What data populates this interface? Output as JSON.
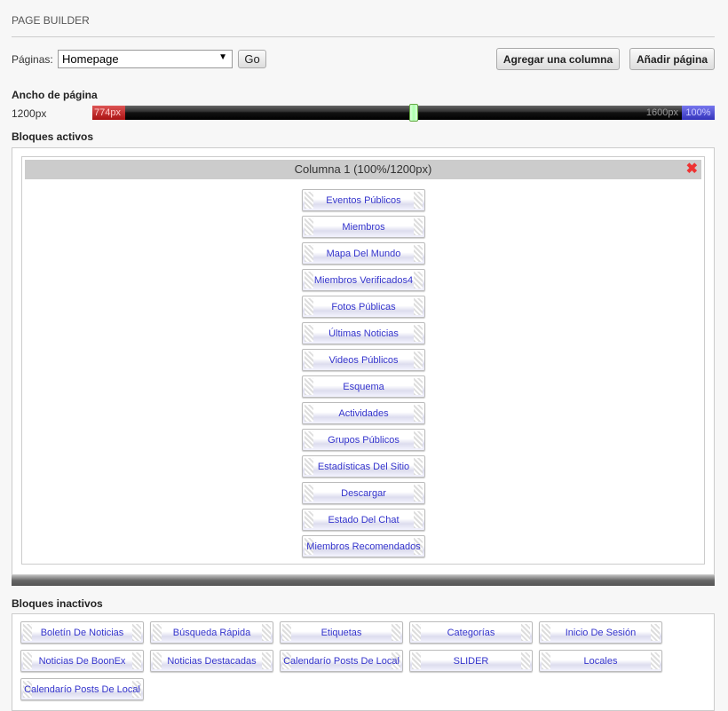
{
  "header": {
    "title": "PAGE BUILDER"
  },
  "toolbar": {
    "pages_label": "Páginas:",
    "selected_page": "Homepage",
    "go_label": "Go",
    "add_column_label": "Agregar una columna",
    "add_page_label": "Añadir página"
  },
  "width": {
    "label": "Ancho de página",
    "value": "1200px",
    "min_label": "774px",
    "max_label": "1600px",
    "percent_label": "100%",
    "min": 774,
    "max": 1600,
    "current": 1200
  },
  "active": {
    "label": "Bloques activos",
    "column_title": "Columna 1 (100%/1200px)",
    "blocks": [
      "Eventos Públicos",
      "Miembros",
      "Mapa Del Mundo",
      "Miembros Verificados4",
      "Fotos Públicas",
      "Últimas Noticias",
      "Videos Públicos",
      "Esquema",
      "Actividades",
      "Grupos Públicos",
      "Estadísticas Del Sitio",
      "Descargar",
      "Estado Del Chat",
      "Miembros Recomendados"
    ]
  },
  "inactive": {
    "label": "Bloques inactivos",
    "blocks": [
      "Boletín De Noticias",
      "Búsqueda Rápida",
      "Etiquetas",
      "Categorías",
      "Inicio De Sesión",
      "Noticias De BoonEx",
      "Noticias Destacadas",
      "Calendarío Posts De Local",
      "SLIDER",
      "Locales",
      "Calendarío Posts De Local"
    ]
  }
}
